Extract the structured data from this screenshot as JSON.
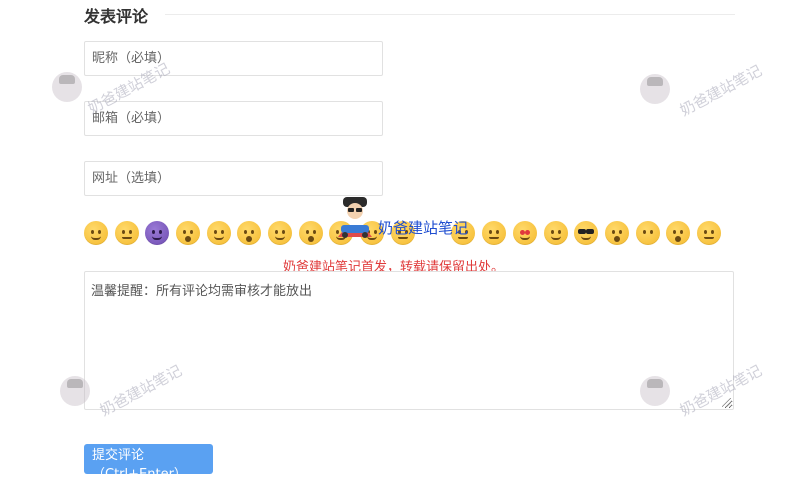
{
  "form": {
    "section_title": "发表评论",
    "nickname_placeholder": "昵称（必填）",
    "email_placeholder": "邮箱（必填）",
    "website_placeholder": "网址（选填）",
    "comment_placeholder": "温馨提醒：所有评论均需审核才能放出",
    "submit_label": "提交评论（Ctrl+Enter）"
  },
  "emojis": [
    "smirk-icon",
    "worried-icon",
    "purple-devil-icon",
    "hushed-icon",
    "laughing-icon",
    "flushed-icon",
    "grinning-icon",
    "scream-icon",
    "relieved-icon",
    "smile-icon",
    "sweat-icon",
    "frowning-icon",
    "triumph-icon",
    "heart-eyes-icon",
    "wink-tongue-icon",
    "sunglasses-icon",
    "kissing-heart-icon",
    "no-mouth-icon",
    "crying-icon",
    "grimacing-icon"
  ],
  "overlay": {
    "notice": "奶爸建站笔记首发，转载请保留出处。",
    "stamp_text": "奶爸建站笔记",
    "watermark": "奶爸建站笔记"
  },
  "colors": {
    "notice": "#e03b3b",
    "stamp_text": "#1f4ed0",
    "submit_bg": "#5aa1f2"
  }
}
